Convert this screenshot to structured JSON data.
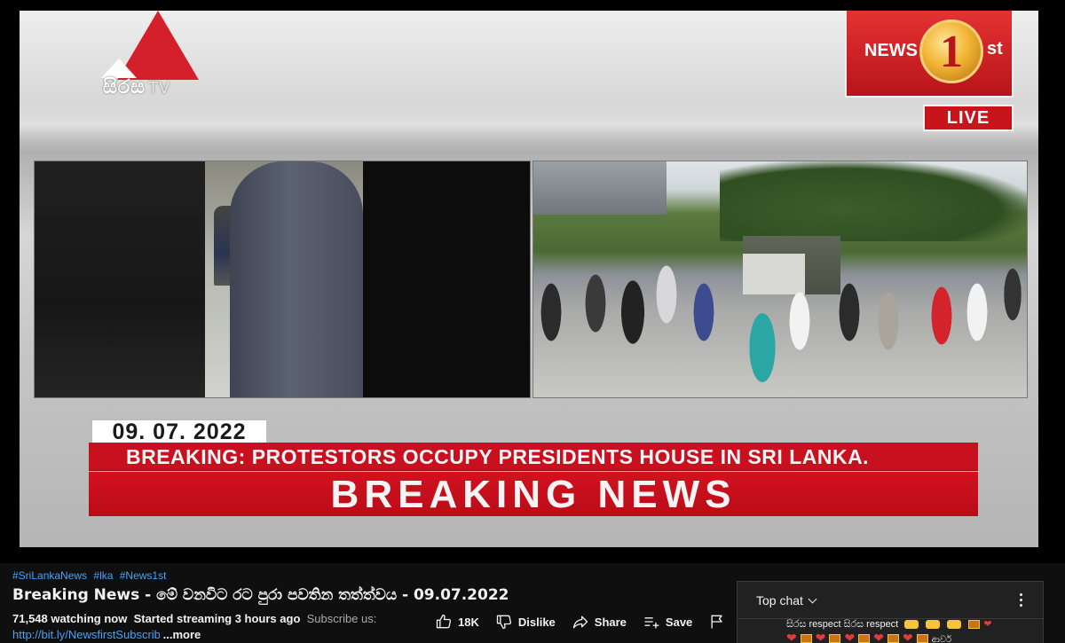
{
  "video": {
    "channel_logo_text": "සිරස",
    "channel_logo_suffix": "TV",
    "news1st_left": "NEWS",
    "news1st_num": "1",
    "news1st_suffix": "st",
    "live_label": "LIVE",
    "date": "09. 07. 2022",
    "headline": "BREAKING: PROTESTORS OCCUPY PRESIDENTS HOUSE IN SRI LANKA.",
    "banner": "BREAKING NEWS"
  },
  "meta": {
    "hashtags": [
      "#SriLankaNews",
      "#lka",
      "#News1st"
    ],
    "title": "Breaking News - මේ වනවිට රට පුරා පවතින තත්ත්වය - 09.07.2022",
    "watching": "71,548 watching now",
    "started": "Started streaming 3 hours ago",
    "subscribe_prompt": "Subscribe us:",
    "link": "http://bit.ly/NewsfirstSubscribe",
    "more": "...more"
  },
  "actions": {
    "like_count": "18K",
    "dislike_label": "Dislike",
    "share_label": "Share",
    "save_label": "Save"
  },
  "chat": {
    "header": "Top chat",
    "message_text": "සිරස respect සිරස respect",
    "message_tail": "ආවර්"
  },
  "icons": {
    "like": "thumbs-up-icon",
    "dislike": "thumbs-down-icon",
    "share": "share-arrow-icon",
    "save": "playlist-add-icon",
    "report": "flag-icon",
    "chat_menu": "more-vert-icon"
  },
  "colors": {
    "accent_red": "#c8101e",
    "link_blue": "#3ea6ff",
    "background": "#0f0f0f"
  }
}
